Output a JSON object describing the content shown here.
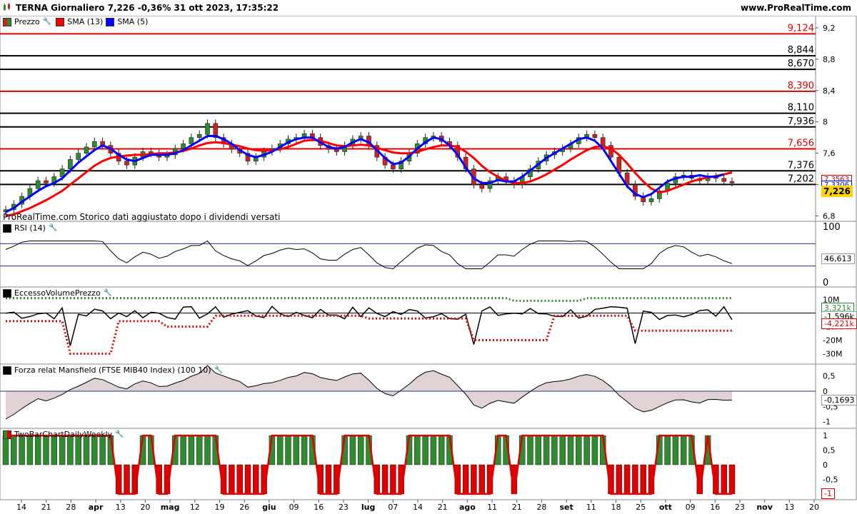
{
  "header": {
    "title": "TERNA Giornaliero 7,226 -0,36% 31 ott 2023, 17:35:22",
    "site": "www.ProRealTime.com"
  },
  "price_panel": {
    "legend": [
      {
        "label": "Prezzo",
        "color": "#2e8b2e"
      },
      {
        "label": "SMA (13)",
        "color": "#ff0000"
      },
      {
        "label": "SMA (5)",
        "color": "#0000ff"
      }
    ],
    "note": "ProRealTime.com  Storico dati aggiustato dopo i dividendi versati",
    "last_price": "7,226",
    "sma13_value": "7,3563",
    "sma5_value": "7,3306",
    "y_ticks": [
      "9,2",
      "8,8",
      "8,4",
      "8",
      "7,6",
      "7,2",
      "6,8"
    ],
    "levels": [
      {
        "label": "9,124",
        "value": 9.124,
        "color": "#e00000"
      },
      {
        "label": "8,844",
        "value": 8.844,
        "color": "#000000"
      },
      {
        "label": "8,670",
        "value": 8.67,
        "color": "#000000"
      },
      {
        "label": "8,390",
        "value": 8.39,
        "color": "#e00000"
      },
      {
        "label": "8,110",
        "value": 8.11,
        "color": "#000000"
      },
      {
        "label": "7,936",
        "value": 7.936,
        "color": "#000000"
      },
      {
        "label": "7,656",
        "value": 7.656,
        "color": "#e00000"
      },
      {
        "label": "7,376",
        "value": 7.376,
        "color": "#000000"
      },
      {
        "label": "7,202",
        "value": 7.202,
        "color": "#000000"
      }
    ]
  },
  "rsi_panel": {
    "legend": "RSI (14)",
    "value": "46,613",
    "y_ticks": [
      "100",
      "0"
    ]
  },
  "evp_panel": {
    "legend": "EccessoVolumePrezzo",
    "upper_value": "3,321k",
    "value": "-1,596k",
    "lower_value": "-4,221k",
    "y_ticks": [
      "10M",
      "-10M",
      "-20M",
      "-30M"
    ]
  },
  "mansfield_panel": {
    "legend": "Forza relat Mansfield (FTSE MIB40 Index) (100 10)",
    "value": "-0,1693",
    "y_ticks": [
      "0,5",
      "0",
      "-0,5",
      "-1"
    ]
  },
  "twobar_panel": {
    "legend": "TwoBarChartDailyWeekly",
    "value": "-1",
    "y_ticks": [
      "1",
      "0,5",
      "0",
      "-0,5",
      "-1"
    ]
  },
  "x_axis": {
    "labels": [
      "14",
      "21",
      "28",
      "apr",
      "13",
      "20",
      "mag",
      "12",
      "19",
      "26",
      "giu",
      "09",
      "16",
      "23",
      "lug",
      "07",
      "14",
      "21",
      "ago",
      "11",
      "21",
      "28",
      "set",
      "11",
      "18",
      "25",
      "ott",
      "09",
      "16",
      "23",
      "nov",
      "13",
      "20"
    ]
  },
  "chart_data": {
    "type": "line",
    "title": "TERNA Giornaliero",
    "x_range_labels": [
      "14",
      "20"
    ],
    "series": [
      {
        "name": "Prezzo",
        "values": [
          6.88,
          6.95,
          7.05,
          7.15,
          7.25,
          7.22,
          7.3,
          7.4,
          7.52,
          7.6,
          7.68,
          7.75,
          7.7,
          7.6,
          7.5,
          7.45,
          7.55,
          7.62,
          7.6,
          7.55,
          7.58,
          7.66,
          7.72,
          7.8,
          7.84,
          7.98,
          7.8,
          7.72,
          7.65,
          7.6,
          7.5,
          7.55,
          7.62,
          7.66,
          7.72,
          7.78,
          7.8,
          7.85,
          7.8,
          7.7,
          7.65,
          7.62,
          7.7,
          7.78,
          7.82,
          7.7,
          7.55,
          7.45,
          7.4,
          7.5,
          7.6,
          7.72,
          7.8,
          7.82,
          7.75,
          7.7,
          7.55,
          7.4,
          7.2,
          7.15,
          7.25,
          7.3,
          7.25,
          7.2,
          7.3,
          7.4,
          7.5,
          7.58,
          7.62,
          7.66,
          7.72,
          7.8,
          7.84,
          7.8,
          7.7,
          7.55,
          7.35,
          7.2,
          7.05,
          6.98,
          7.02,
          7.12,
          7.22,
          7.3,
          7.32,
          7.28,
          7.25,
          7.3,
          7.28,
          7.24,
          7.226
        ]
      },
      {
        "name": "SMA (13)",
        "values": [
          6.8,
          6.82,
          6.86,
          6.9,
          6.95,
          7.0,
          7.06,
          7.12,
          7.2,
          7.28,
          7.36,
          7.44,
          7.5,
          7.54,
          7.56,
          7.57,
          7.58,
          7.58,
          7.59,
          7.6,
          7.6,
          7.61,
          7.63,
          7.66,
          7.7,
          7.73,
          7.74,
          7.73,
          7.71,
          7.69,
          7.66,
          7.64,
          7.63,
          7.64,
          7.65,
          7.68,
          7.72,
          7.76,
          7.77,
          7.76,
          7.73,
          7.7,
          7.69,
          7.7,
          7.71,
          7.7,
          7.67,
          7.64,
          7.61,
          7.6,
          7.6,
          7.62,
          7.65,
          7.68,
          7.7,
          7.7,
          7.68,
          7.62,
          7.54,
          7.44,
          7.36,
          7.3,
          7.25,
          7.22,
          7.22,
          7.24,
          7.28,
          7.33,
          7.39,
          7.45,
          7.52,
          7.58,
          7.64,
          7.68,
          7.69,
          7.66,
          7.58,
          7.47,
          7.35,
          7.24,
          7.15,
          7.1,
          7.12,
          7.16,
          7.2,
          7.24,
          7.27,
          7.29,
          7.31,
          7.33,
          7.356
        ]
      },
      {
        "name": "SMA (5)",
        "values": [
          6.85,
          6.9,
          6.98,
          7.05,
          7.12,
          7.18,
          7.22,
          7.28,
          7.38,
          7.48,
          7.56,
          7.64,
          7.7,
          7.66,
          7.58,
          7.52,
          7.5,
          7.54,
          7.58,
          7.58,
          7.58,
          7.6,
          7.64,
          7.7,
          7.76,
          7.82,
          7.82,
          7.78,
          7.72,
          7.64,
          7.58,
          7.55,
          7.58,
          7.62,
          7.68,
          7.74,
          7.78,
          7.8,
          7.8,
          7.74,
          7.68,
          7.66,
          7.68,
          7.74,
          7.78,
          7.74,
          7.64,
          7.54,
          7.46,
          7.48,
          7.56,
          7.66,
          7.74,
          7.8,
          7.78,
          7.7,
          7.58,
          7.42,
          7.28,
          7.22,
          7.22,
          7.26,
          7.24,
          7.24,
          7.3,
          7.38,
          7.46,
          7.54,
          7.6,
          7.66,
          7.72,
          7.78,
          7.8,
          7.76,
          7.66,
          7.5,
          7.34,
          7.18,
          7.08,
          7.04,
          7.08,
          7.16,
          7.24,
          7.28,
          7.3,
          7.3,
          7.32,
          7.3,
          7.3,
          7.331
        ]
      }
    ],
    "ylim": [
      6.75,
      9.3
    ]
  },
  "colors": {
    "up": "#2e8b2e",
    "down": "#cc2222",
    "sma13": "#ff0000",
    "sma5": "#0000ff",
    "green_dots": "#2e8b2e",
    "red_dots": "#e00000"
  }
}
